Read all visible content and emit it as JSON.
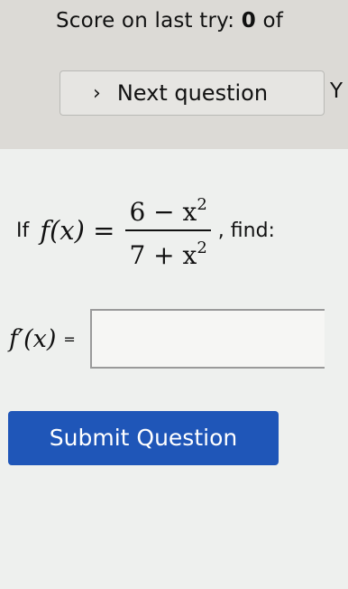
{
  "score": {
    "label": "Score on last try:",
    "value": "0",
    "suffix": "of"
  },
  "next_button": {
    "chevron": "›",
    "label": "Next question",
    "cut_text": "Y"
  },
  "question": {
    "prefix": "If",
    "function": "f(x) =",
    "numerator": "6 − x",
    "numerator_exp": "2",
    "denominator": "7 + x",
    "denominator_exp": "2",
    "suffix": ", find:"
  },
  "answer": {
    "label": "f′(x)",
    "equals": "=",
    "value": ""
  },
  "submit": {
    "label": "Submit Question",
    "color": "#1f56b8"
  }
}
